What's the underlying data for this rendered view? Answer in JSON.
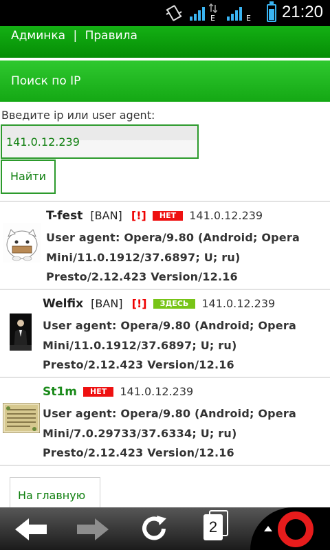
{
  "status_bar": {
    "time": "21:20",
    "signal_letter_1": "E",
    "signal_letter_2": "E",
    "icons": [
      "vibrate-icon",
      "signal-icon",
      "signal-icon",
      "battery-icon"
    ],
    "accent_color": "#3ab4f2"
  },
  "header": {
    "admin_link": "Админка",
    "separator": "|",
    "rules_link": "Правила",
    "color": "#0a9a0a"
  },
  "search_section": {
    "title": "Поиск по IP"
  },
  "form": {
    "label": "Введите ip или user agent:",
    "input_value": "141.0.12.239",
    "submit_label": "Найти"
  },
  "entries": [
    {
      "nick": "T-fest",
      "ban_tag": "[BAN]",
      "warn_tag": "[!]",
      "status": "НЕТ",
      "ip": "141.0.12.239",
      "ua_lines": [
        "User agent: Opera/9.80 (Android; Opera",
        "Mini/11.0.1912/37.6897; U; ru)",
        "Presto/2.12.423 Version/12.16"
      ]
    },
    {
      "nick": "Welfix",
      "ban_tag": "[BAN]",
      "warn_tag": "[!]",
      "status": "ЗДЕСЬ",
      "ip": "141.0.12.239",
      "ua_lines": [
        "User agent: Opera/9.80 (Android; Opera",
        "Mini/11.0.1912/37.6897; U; ru)",
        "Presto/2.12.423 Version/12.16"
      ]
    },
    {
      "nick": "St1m",
      "ban_tag": "",
      "warn_tag": "",
      "status": "НЕТ",
      "ip": "141.0.12.239",
      "ua_lines": [
        "User agent: Opera/9.80 (Android; Opera",
        "Mini/7.0.29733/37.6334; U; ru)",
        "Presto/2.12.423 Version/12.16"
      ]
    }
  ],
  "footer": {
    "home_link": "На главную"
  },
  "browser_bar": {
    "tab_count": "2",
    "icons": [
      "back-arrow-icon",
      "forward-arrow-icon",
      "reload-icon",
      "tabs-icon",
      "opera-menu-icon"
    ]
  }
}
